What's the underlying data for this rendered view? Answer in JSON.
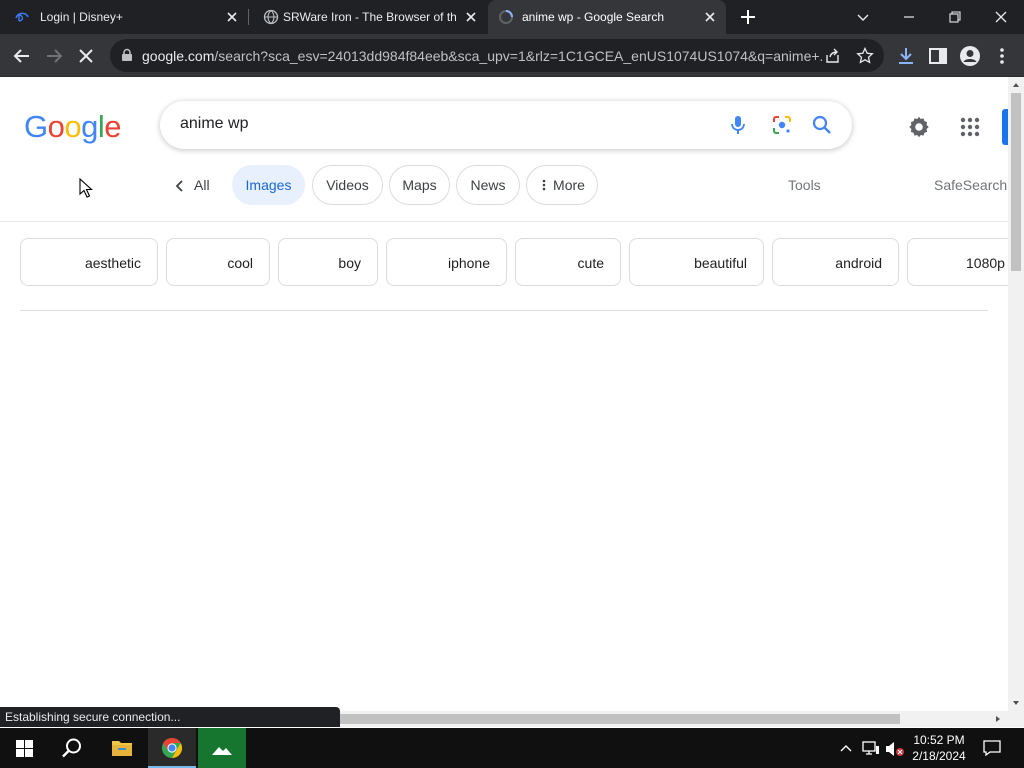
{
  "browser": {
    "tabs": [
      {
        "title": "Login | Disney+",
        "favicon": "disney-plus-icon",
        "active": false
      },
      {
        "title": "SRWare Iron - The Browser of the",
        "favicon": "globe-icon",
        "active": false
      },
      {
        "title": "anime wp - Google Search",
        "favicon": "loading-spinner-icon",
        "active": true
      }
    ],
    "address": {
      "host": "google.com",
      "path": "/search?sca_esv=24013dd984f84eeb&sca_upv=1&rlz=1C1GCEA_enUS1074US1074&q=anime+..."
    }
  },
  "google": {
    "logo": "Google",
    "query": "anime wp",
    "nav": {
      "back_label": "All",
      "tabs": [
        {
          "label": "Images",
          "selected": true
        },
        {
          "label": "Videos",
          "selected": false
        },
        {
          "label": "Maps",
          "selected": false
        },
        {
          "label": "News",
          "selected": false
        },
        {
          "label": "More",
          "selected": false
        }
      ],
      "tools": "Tools",
      "safesearch": "SafeSearch"
    },
    "suggestions": [
      "aesthetic",
      "cool",
      "boy",
      "iphone",
      "cute",
      "beautiful",
      "android",
      "1080p"
    ]
  },
  "status_text": "Establishing secure connection...",
  "taskbar": {
    "time": "10:52 PM",
    "date": "2/18/2024"
  },
  "colors": {
    "google_blue": "#4285F4",
    "google_red": "#EA4335",
    "google_yellow": "#FBBC05",
    "google_green": "#34A853",
    "chrome_dark": "#202124",
    "chrome_toolbar": "#35363a"
  }
}
